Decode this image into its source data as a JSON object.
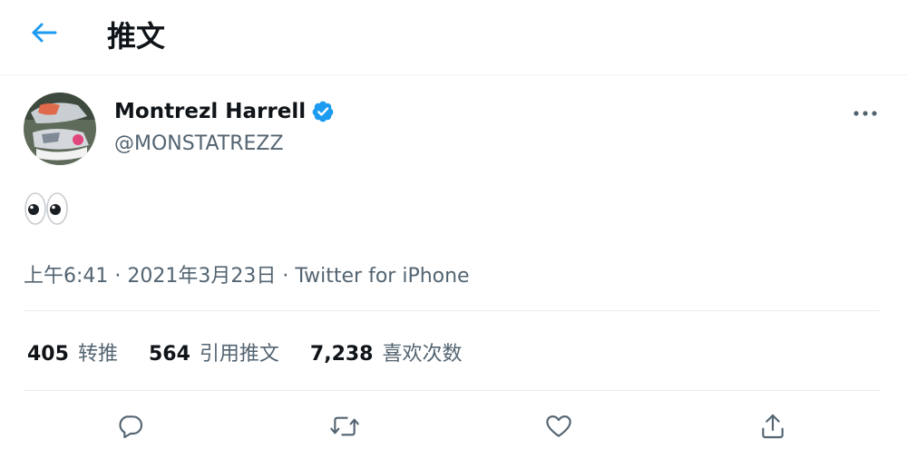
{
  "header": {
    "back_icon": "arrow-left-icon",
    "title": "推文",
    "accent_color": "#1d9bf0"
  },
  "tweet": {
    "author": {
      "name": "Montrezl Harrell",
      "handle": "@MONSTATREZZ",
      "verified": true,
      "avatar": "sneakers-photo"
    },
    "text": "👀",
    "time": "上午6:41",
    "separator": " · ",
    "date": "2021年3月23日",
    "source": "Twitter for iPhone"
  },
  "stats": [
    {
      "value": "405",
      "label": "转推"
    },
    {
      "value": "564",
      "label": "引用推文"
    },
    {
      "value": "7,238",
      "label": "喜欢次数"
    }
  ],
  "actions": [
    {
      "icon": "reply-icon"
    },
    {
      "icon": "retweet-icon"
    },
    {
      "icon": "like-icon"
    },
    {
      "icon": "share-icon"
    }
  ],
  "colors": {
    "text_primary": "#0f1419",
    "text_secondary": "#536471",
    "verified_blue": "#1d9bf0",
    "divider": "#eff3f4"
  }
}
